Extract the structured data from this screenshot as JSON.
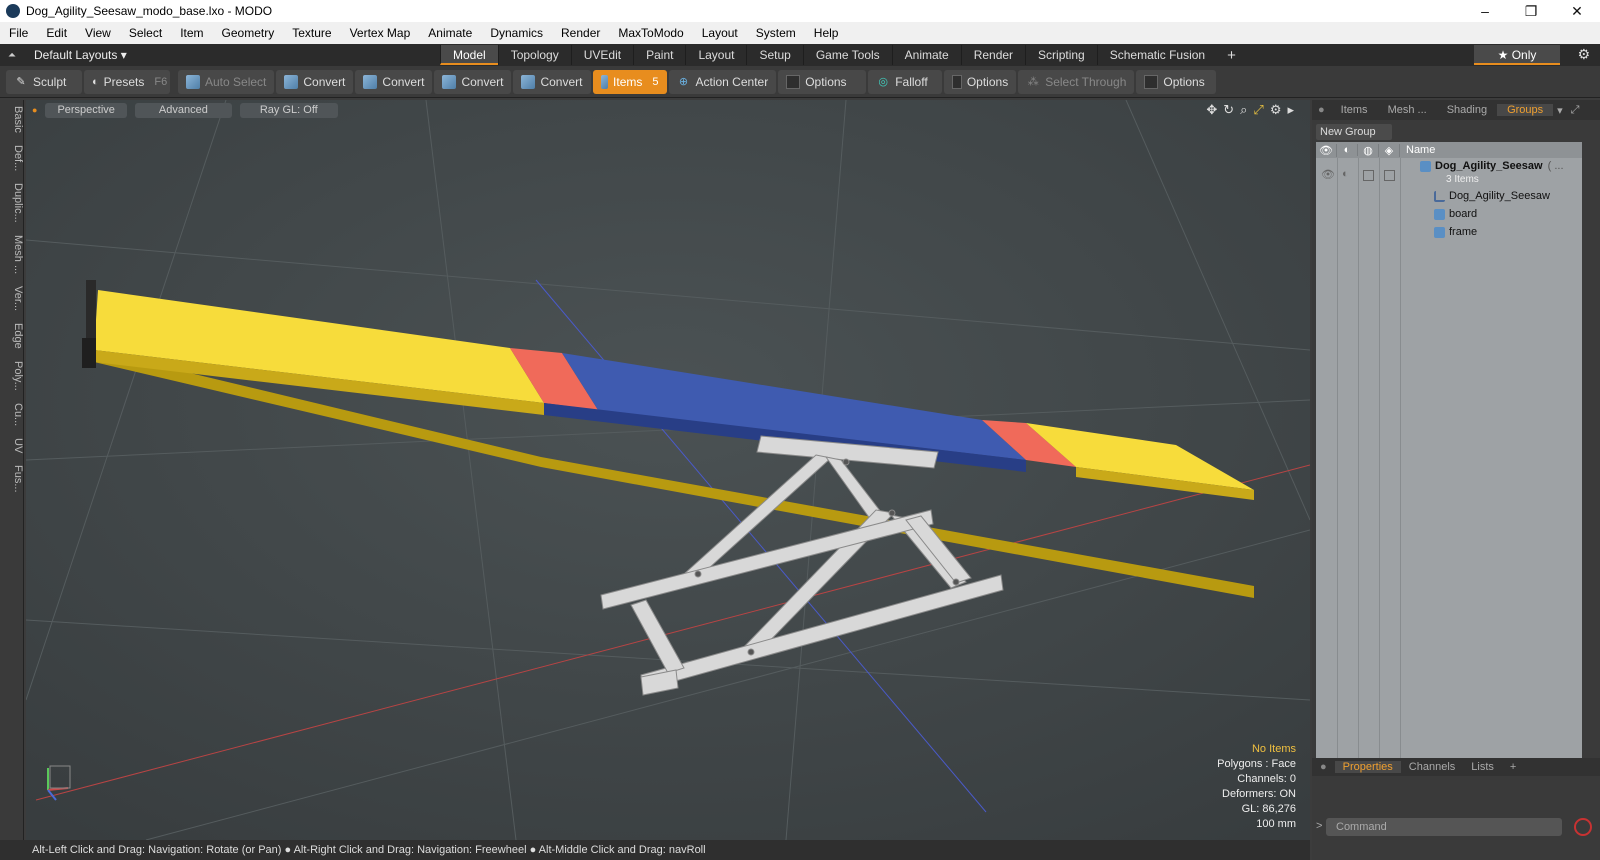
{
  "window": {
    "title": "Dog_Agility_Seesaw_modo_base.lxo - MODO",
    "minimize": "–",
    "restore": "❐",
    "close": "✕"
  },
  "menu": [
    "File",
    "Edit",
    "View",
    "Select",
    "Item",
    "Geometry",
    "Texture",
    "Vertex Map",
    "Animate",
    "Dynamics",
    "Render",
    "MaxToModo",
    "Layout",
    "System",
    "Help"
  ],
  "layouts": {
    "label": "Default Layouts ▾"
  },
  "main_tabs": [
    {
      "label": "Model",
      "active": true
    },
    {
      "label": "Topology"
    },
    {
      "label": "UVEdit"
    },
    {
      "label": "Paint"
    },
    {
      "label": "Layout"
    },
    {
      "label": "Setup"
    },
    {
      "label": "Game Tools"
    },
    {
      "label": "Animate"
    },
    {
      "label": "Render"
    },
    {
      "label": "Scripting"
    },
    {
      "label": "Schematic Fusion"
    }
  ],
  "tabs_plus": "+",
  "only_label": "★  Only",
  "toolbar": {
    "sculpt": "Sculpt",
    "presets": "Presets",
    "presets_hotkey": "F6",
    "auto_select": "Auto Select",
    "convert": "Convert",
    "items": "Items",
    "items_count": "5",
    "action_center": "Action Center",
    "options": "Options",
    "falloff": "Falloff",
    "select_through": "Select Through"
  },
  "left_tabs": [
    "Basic",
    "Def...",
    "Duplic...",
    "Mesh ...",
    "Ver...",
    "Edge",
    "Poly...",
    "Cu...",
    "UV",
    "Fus..."
  ],
  "viewport": {
    "perspective": "Perspective",
    "advanced": "Advanced",
    "raygl": "Ray GL: Off",
    "info": {
      "no_items": "No Items",
      "polygons": "Polygons : Face",
      "channels": "Channels: 0",
      "deformers": "Deformers: ON",
      "gl": "GL: 86,276",
      "unit": "100 mm"
    }
  },
  "status": "Alt-Left Click and Drag: Navigation: Rotate (or Pan) ● Alt-Right Click and Drag: Navigation: Freewheel ● Alt-Middle Click and Drag: navRoll",
  "right_panel": {
    "tabs": [
      {
        "label": "Items"
      },
      {
        "label": "Mesh ..."
      },
      {
        "label": "Shading"
      },
      {
        "label": "Groups",
        "active": true
      }
    ],
    "new_group": "New Group",
    "name_col": "Name",
    "group_name": "Dog_Agility_Seesaw",
    "group_suffix": "( ...",
    "group_count": "3 Items",
    "children": [
      "Dog_Agility_Seesaw",
      "board",
      "frame"
    ],
    "props_tabs": [
      {
        "label": "Properties",
        "active": true
      },
      {
        "label": "Channels"
      },
      {
        "label": "Lists"
      },
      {
        "label": "+"
      }
    ],
    "command_placeholder": "Command",
    "command_prompt": ">"
  },
  "colors": {
    "accent": "#e88d1e",
    "board_yellow": "#f7dc3b",
    "board_blue": "#3f5bb0",
    "board_red": "#f06a5a",
    "frame": "#d8d8d8"
  }
}
